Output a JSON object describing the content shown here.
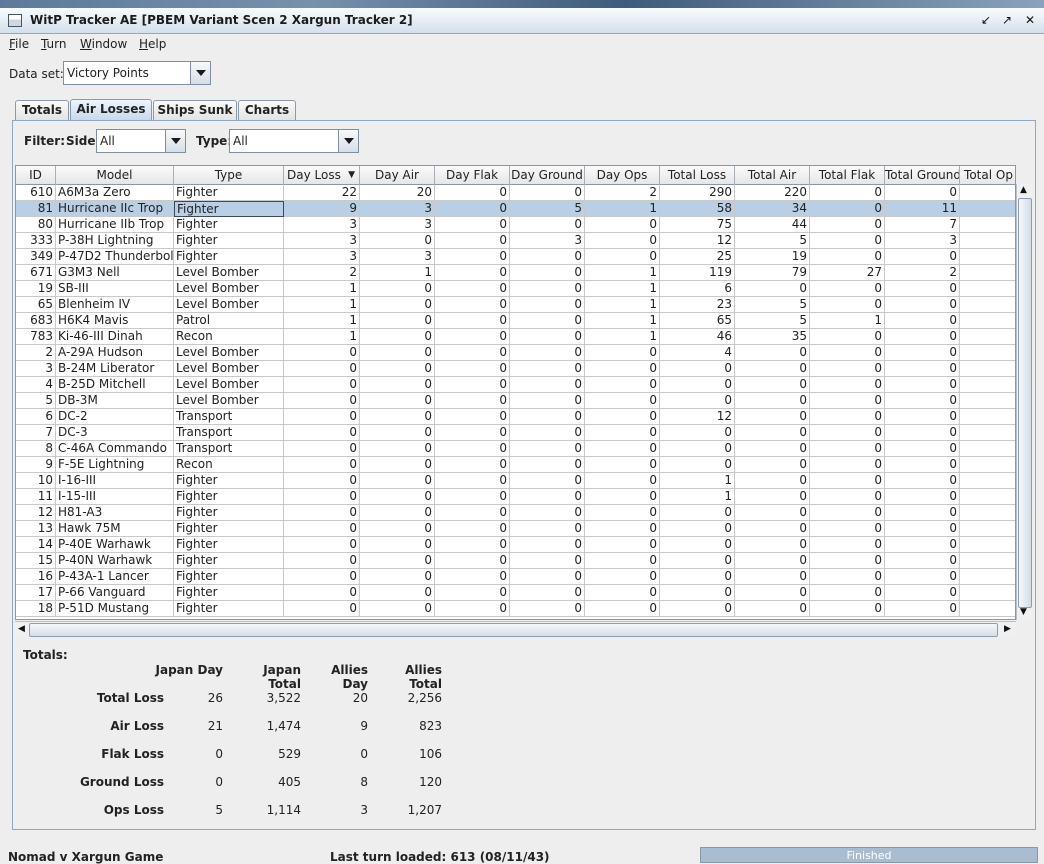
{
  "window": {
    "title": "WitP Tracker AE [PBEM Variant Scen 2 Xargun Tracker 2]"
  },
  "menu": [
    {
      "mnemonic": "F",
      "rest": "ile"
    },
    {
      "mnemonic": "T",
      "rest": "urn"
    },
    {
      "mnemonic": "W",
      "rest": "indow"
    },
    {
      "mnemonic": "H",
      "rest": "elp"
    }
  ],
  "dataset": {
    "label": "Data set:",
    "value": "Victory Points"
  },
  "tabs": [
    "Totals",
    "Air Losses",
    "Ships Sunk",
    "Charts"
  ],
  "active_tab": "Air Losses",
  "filter": {
    "label": "Filter:",
    "side_label": "Side:",
    "side_value": "All",
    "type_label": "Type:",
    "type_value": "All"
  },
  "table": {
    "columns": [
      "ID",
      "Model",
      "Type",
      "Day Loss",
      "Day Air",
      "Day Flak",
      "Day Ground",
      "Day Ops",
      "Total Loss",
      "Total Air",
      "Total Flak",
      "Total Ground",
      "Total Op"
    ],
    "sorted_column": "Day Loss",
    "selected_row": 1,
    "rows": [
      [
        "610",
        "A6M3a Zero",
        "Fighter",
        "22",
        "20",
        "0",
        "0",
        "2",
        "290",
        "220",
        "0",
        "0",
        ""
      ],
      [
        "81",
        "Hurricane IIc Trop",
        "Fighter",
        "9",
        "3",
        "0",
        "5",
        "1",
        "58",
        "34",
        "0",
        "11",
        ""
      ],
      [
        "80",
        "Hurricane IIb Trop",
        "Fighter",
        "3",
        "3",
        "0",
        "0",
        "0",
        "75",
        "44",
        "0",
        "7",
        ""
      ],
      [
        "333",
        "P-38H Lightning",
        "Fighter",
        "3",
        "0",
        "0",
        "3",
        "0",
        "12",
        "5",
        "0",
        "3",
        ""
      ],
      [
        "349",
        "P-47D2 Thunderbolt",
        "Fighter",
        "3",
        "3",
        "0",
        "0",
        "0",
        "25",
        "19",
        "0",
        "0",
        ""
      ],
      [
        "671",
        "G3M3 Nell",
        "Level Bomber",
        "2",
        "1",
        "0",
        "0",
        "1",
        "119",
        "79",
        "27",
        "2",
        ""
      ],
      [
        "19",
        "SB-III",
        "Level Bomber",
        "1",
        "0",
        "0",
        "0",
        "1",
        "6",
        "0",
        "0",
        "0",
        ""
      ],
      [
        "65",
        "Blenheim IV",
        "Level Bomber",
        "1",
        "0",
        "0",
        "0",
        "1",
        "23",
        "5",
        "0",
        "0",
        ""
      ],
      [
        "683",
        "H6K4 Mavis",
        "Patrol",
        "1",
        "0",
        "0",
        "0",
        "1",
        "65",
        "5",
        "1",
        "0",
        ""
      ],
      [
        "783",
        "Ki-46-III Dinah",
        "Recon",
        "1",
        "0",
        "0",
        "0",
        "1",
        "46",
        "35",
        "0",
        "0",
        ""
      ],
      [
        "2",
        "A-29A Hudson",
        "Level Bomber",
        "0",
        "0",
        "0",
        "0",
        "0",
        "4",
        "0",
        "0",
        "0",
        ""
      ],
      [
        "3",
        "B-24M Liberator",
        "Level Bomber",
        "0",
        "0",
        "0",
        "0",
        "0",
        "0",
        "0",
        "0",
        "0",
        ""
      ],
      [
        "4",
        "B-25D Mitchell",
        "Level Bomber",
        "0",
        "0",
        "0",
        "0",
        "0",
        "0",
        "0",
        "0",
        "0",
        ""
      ],
      [
        "5",
        "DB-3M",
        "Level Bomber",
        "0",
        "0",
        "0",
        "0",
        "0",
        "0",
        "0",
        "0",
        "0",
        ""
      ],
      [
        "6",
        "DC-2",
        "Transport",
        "0",
        "0",
        "0",
        "0",
        "0",
        "12",
        "0",
        "0",
        "0",
        ""
      ],
      [
        "7",
        "DC-3",
        "Transport",
        "0",
        "0",
        "0",
        "0",
        "0",
        "0",
        "0",
        "0",
        "0",
        ""
      ],
      [
        "8",
        "C-46A Commando",
        "Transport",
        "0",
        "0",
        "0",
        "0",
        "0",
        "0",
        "0",
        "0",
        "0",
        ""
      ],
      [
        "9",
        "F-5E Lightning",
        "Recon",
        "0",
        "0",
        "0",
        "0",
        "0",
        "0",
        "0",
        "0",
        "0",
        ""
      ],
      [
        "10",
        "I-16-III",
        "Fighter",
        "0",
        "0",
        "0",
        "0",
        "0",
        "1",
        "0",
        "0",
        "0",
        ""
      ],
      [
        "11",
        "I-15-III",
        "Fighter",
        "0",
        "0",
        "0",
        "0",
        "0",
        "1",
        "0",
        "0",
        "0",
        ""
      ],
      [
        "12",
        "H81-A3",
        "Fighter",
        "0",
        "0",
        "0",
        "0",
        "0",
        "0",
        "0",
        "0",
        "0",
        ""
      ],
      [
        "13",
        "Hawk 75M",
        "Fighter",
        "0",
        "0",
        "0",
        "0",
        "0",
        "0",
        "0",
        "0",
        "0",
        ""
      ],
      [
        "14",
        "P-40E Warhawk",
        "Fighter",
        "0",
        "0",
        "0",
        "0",
        "0",
        "0",
        "0",
        "0",
        "0",
        ""
      ],
      [
        "15",
        "P-40N Warhawk",
        "Fighter",
        "0",
        "0",
        "0",
        "0",
        "0",
        "0",
        "0",
        "0",
        "0",
        ""
      ],
      [
        "16",
        "P-43A-1 Lancer",
        "Fighter",
        "0",
        "0",
        "0",
        "0",
        "0",
        "0",
        "0",
        "0",
        "0",
        ""
      ],
      [
        "17",
        "P-66 Vanguard",
        "Fighter",
        "0",
        "0",
        "0",
        "0",
        "0",
        "0",
        "0",
        "0",
        "0",
        ""
      ],
      [
        "18",
        "P-51D Mustang",
        "Fighter",
        "0",
        "0",
        "0",
        "0",
        "0",
        "0",
        "0",
        "0",
        "0",
        ""
      ]
    ]
  },
  "totals": {
    "label": "Totals:",
    "headers": [
      "Japan Day",
      "Japan Total",
      "Allies Day",
      "Allies Total"
    ],
    "rows": [
      {
        "label": "Total Loss",
        "values": [
          "26",
          "3,522",
          "20",
          "2,256"
        ]
      },
      {
        "label": "Air Loss",
        "values": [
          "21",
          "1,474",
          "9",
          "823"
        ]
      },
      {
        "label": "Flak Loss",
        "values": [
          "0",
          "529",
          "0",
          "106"
        ]
      },
      {
        "label": "Ground Loss",
        "values": [
          "0",
          "405",
          "8",
          "120"
        ]
      },
      {
        "label": "Ops Loss",
        "values": [
          "5",
          "1,114",
          "3",
          "1,207"
        ]
      }
    ]
  },
  "status": {
    "game": "Nomad v Xargun Game",
    "last_turn": "Last turn loaded: 613 (08/11/43)",
    "progress": "Finished"
  }
}
